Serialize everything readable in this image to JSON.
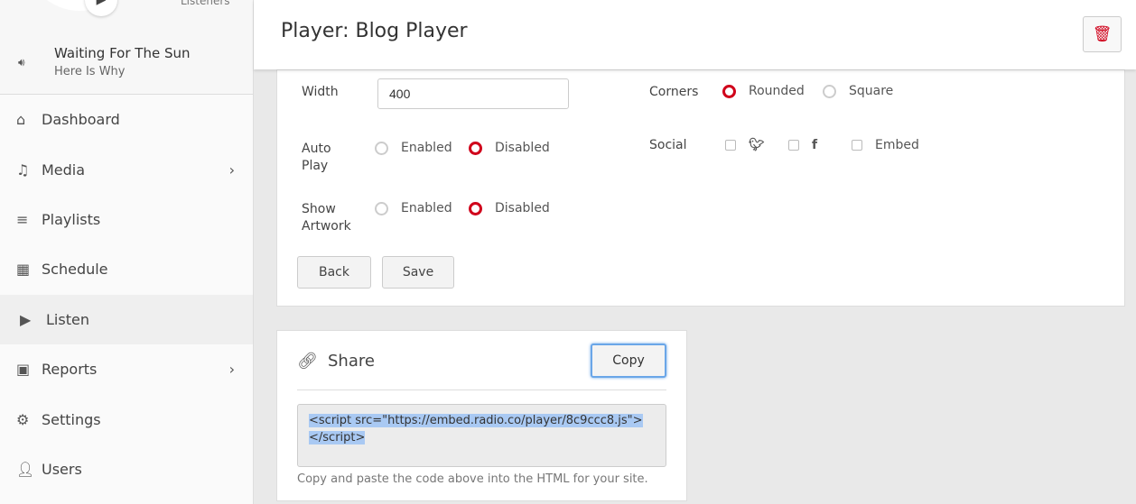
{
  "sidebar": {
    "listeners": "Listeners",
    "now_playing": {
      "title": "Waiting For The Sun",
      "artist": "Here Is Why"
    },
    "items": [
      {
        "label": "Dashboard",
        "icon": "home-icon"
      },
      {
        "label": "Media",
        "icon": "music-icon",
        "chevron": true
      },
      {
        "label": "Playlists",
        "icon": "list-icon"
      },
      {
        "label": "Schedule",
        "icon": "calendar-icon"
      },
      {
        "label": "Listen",
        "icon": "play-icon",
        "active": true
      },
      {
        "label": "Reports",
        "icon": "presentation-icon",
        "chevron": true
      },
      {
        "label": "Settings",
        "icon": "gear-icon"
      },
      {
        "label": "Users",
        "icon": "user-icon"
      }
    ]
  },
  "header": {
    "title": "Player: Blog Player"
  },
  "form": {
    "width_label": "Width",
    "width_value": "400",
    "autoplay_label": "Auto Play",
    "artwork_label": "Show Artwork",
    "enabled": "Enabled",
    "disabled": "Disabled",
    "corners_label": "Corners",
    "rounded": "Rounded",
    "square": "Square",
    "social_label": "Social",
    "embed": "Embed",
    "back": "Back",
    "save": "Save"
  },
  "share": {
    "title": "Share",
    "copy": "Copy",
    "code_line1": "<script src=\"https://embed.radio.co/player/8c9ccc8.js\">",
    "code_line2": "</script>",
    "help": "Copy and paste the code above into the HTML for your site."
  },
  "colors": {
    "accent": "#d0021b",
    "selection": "#a9c9f3"
  }
}
